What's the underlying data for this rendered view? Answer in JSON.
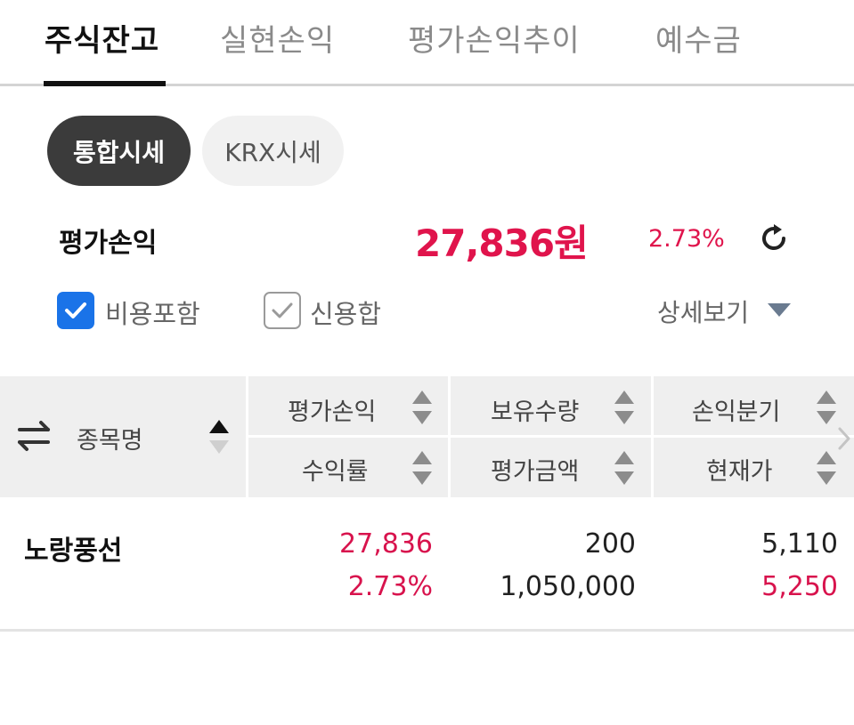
{
  "tabs": {
    "items": [
      {
        "label": "주식잔고",
        "active": true
      },
      {
        "label": "실현손익",
        "active": false
      },
      {
        "label": "평가손익추이",
        "active": false
      },
      {
        "label": "예수금",
        "active": false
      }
    ]
  },
  "price_mode": {
    "options": [
      {
        "label": "통합시세",
        "selected": true
      },
      {
        "label": "KRX시세",
        "selected": false
      }
    ]
  },
  "summary": {
    "label": "평가손익",
    "amount": "27,836원",
    "rate": "2.73%",
    "refresh_icon": "refresh-icon"
  },
  "options": {
    "include_fees": {
      "label": "비용포함",
      "checked": true
    },
    "credit_sum": {
      "label": "신용합",
      "checked": true
    },
    "detail_label": "상세보기"
  },
  "table": {
    "headers": {
      "name": "종목명",
      "eval_pl": "평가손익",
      "quantity": "보유수량",
      "breakeven": "손익분기",
      "return_rate": "수익률",
      "eval_amount": "평가금액",
      "current_price": "현재가"
    },
    "rows": [
      {
        "name": "노랑풍선",
        "eval_pl": "27,836",
        "return_rate": "2.73%",
        "quantity": "200",
        "eval_amount": "1,050,000",
        "breakeven": "5,110",
        "current_price": "5,250"
      }
    ]
  },
  "colors": {
    "gain": "#e0144c",
    "checkbox_blue": "#1a73e8",
    "active_pill": "#3b3b3b"
  }
}
